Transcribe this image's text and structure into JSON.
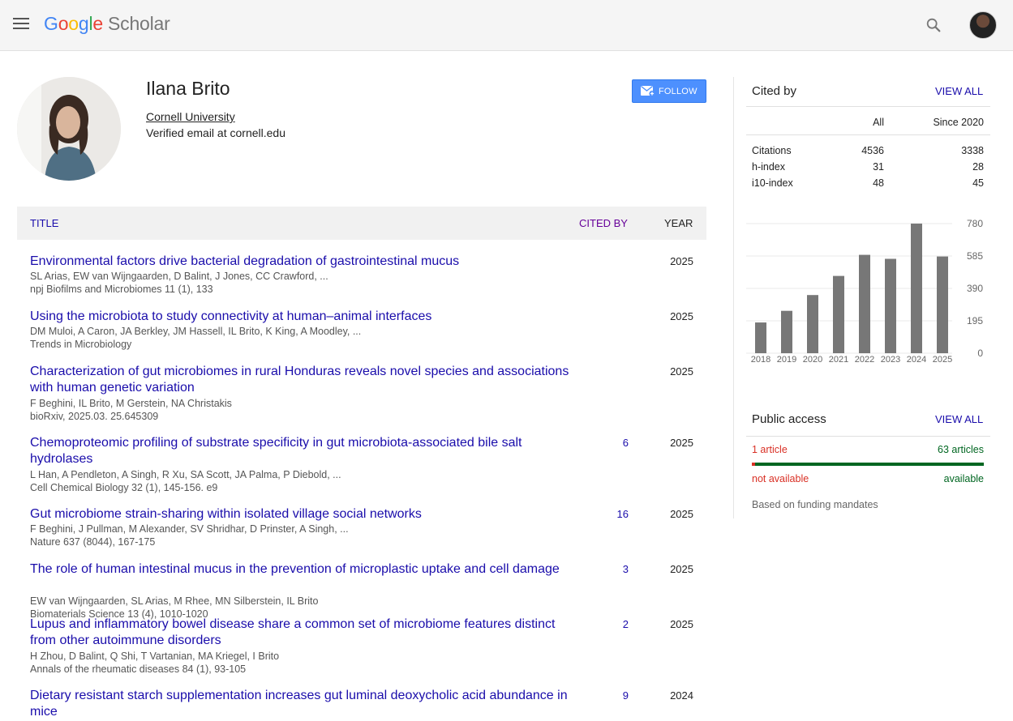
{
  "header": {
    "logo_google": "Google",
    "logo_scholar": "Scholar"
  },
  "profile": {
    "name": "Ilana Brito",
    "affiliation": "Cornell University",
    "email": "Verified email at cornell.edu",
    "follow_label": "FOLLOW"
  },
  "table": {
    "headers": {
      "title": "TITLE",
      "cited_by": "CITED BY",
      "year": "YEAR"
    },
    "rows": [
      {
        "title": "Environmental factors drive bacterial degradation of gastrointestinal mucus",
        "authors": "SL Arias, EW van Wijngaarden, D Balint, J Jones, CC Crawford, ...",
        "venue": "npj Biofilms and Microbiomes 11 (1), 133",
        "cited_by": "",
        "year": "2025"
      },
      {
        "title": "Using the microbiota to study connectivity at human–animal interfaces",
        "authors": "DM Muloi, A Caron, JA Berkley, JM Hassell, IL Brito, K King, A Moodley, ...",
        "venue": "Trends in Microbiology",
        "cited_by": "",
        "year": "2025"
      },
      {
        "title": "Characterization of gut microbiomes in rural Honduras reveals novel species and associations with human genetic variation",
        "authors": "F Beghini, IL Brito, M Gerstein, NA Christakis",
        "venue": "bioRxiv, 2025.03. 25.645309",
        "cited_by": "",
        "year": "2025"
      },
      {
        "title": "Chemoproteomic profiling of substrate specificity in gut microbiota-associated bile salt hydrolases",
        "authors": "L Han, A Pendleton, A Singh, R Xu, SA Scott, JA Palma, P Diebold, ...",
        "venue": "Cell Chemical Biology 32 (1), 145-156. e9",
        "cited_by": "6",
        "year": "2025"
      },
      {
        "title": "Gut microbiome strain-sharing within isolated village social networks",
        "authors": "F Beghini, J Pullman, M Alexander, SV Shridhar, D Prinster, A Singh, ...",
        "venue": "Nature 637 (8044), 167-175",
        "cited_by": "16",
        "year": "2025"
      },
      {
        "title": "The role of human intestinal mucus in the prevention of microplastic uptake and cell damage",
        "authors": "EW van Wijngaarden, SL Arias, M Rhee, MN Silberstein, IL Brito",
        "venue": "Biomaterials Science 13 (4), 1010-1020",
        "cited_by": "3",
        "year": "2025"
      },
      {
        "title": "Lupus and inflammatory bowel disease share a common set of microbiome features distinct from other autoimmune disorders",
        "authors": "H Zhou, D Balint, Q Shi, T Vartanian, MA Kriegel, I Brito",
        "venue": "Annals of the rheumatic diseases 84 (1), 93-105",
        "cited_by": "2",
        "year": "2025"
      },
      {
        "title": "Dietary resistant starch supplementation increases gut luminal deoxycholic acid abundance in mice",
        "authors": "",
        "venue": "",
        "cited_by": "9",
        "year": "2024"
      }
    ]
  },
  "cited_by": {
    "heading": "Cited by",
    "view_all": "VIEW ALL",
    "col_all": "All",
    "col_since": "Since 2020",
    "stats": [
      {
        "label": "Citations",
        "all": "4536",
        "since": "3338"
      },
      {
        "label": "h-index",
        "all": "31",
        "since": "28"
      },
      {
        "label": "i10-index",
        "all": "48",
        "since": "45"
      }
    ]
  },
  "chart_data": {
    "type": "bar",
    "categories": [
      "2018",
      "2019",
      "2020",
      "2021",
      "2022",
      "2023",
      "2024",
      "2025"
    ],
    "values": [
      185,
      255,
      350,
      465,
      592,
      568,
      780,
      582
    ],
    "yticks": [
      "780",
      "585",
      "390",
      "195",
      "0"
    ],
    "ylim": [
      0,
      780
    ],
    "grid": true,
    "bar_color": "#777777"
  },
  "public_access": {
    "heading": "Public access",
    "view_all": "VIEW ALL",
    "not_available_count": "1 article",
    "available_count": "63 articles",
    "not_available_label": "not available",
    "available_label": "available",
    "not_available_fraction": 0.0156,
    "footnote": "Based on funding mandates"
  },
  "colors": {
    "link": "#1a0dab",
    "follow": "#4d90fe",
    "not_available": "#d93025",
    "available": "#006621"
  }
}
